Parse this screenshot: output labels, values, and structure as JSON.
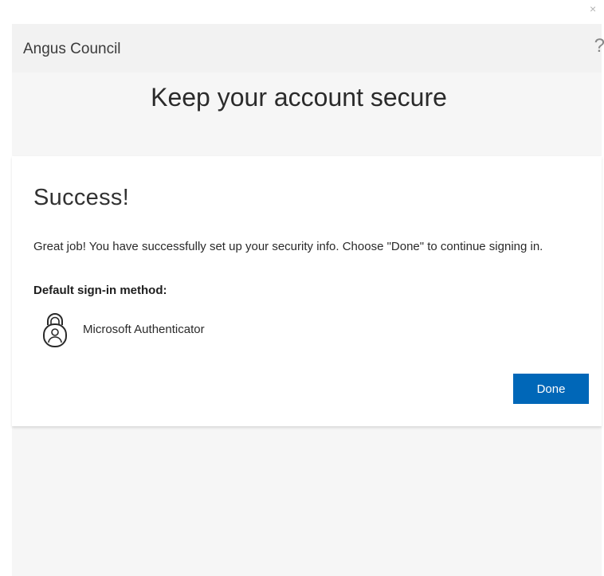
{
  "window": {
    "close_glyph": "×"
  },
  "header": {
    "org_name": "Angus Council",
    "help_glyph": "?"
  },
  "page": {
    "title": "Keep your account secure"
  },
  "card": {
    "heading": "Success!",
    "message": "Great job! You have successfully set up your security info. Choose \"Done\" to continue signing in.",
    "default_label": "Default sign-in method:",
    "method": {
      "name": "Microsoft Authenticator",
      "icon": "authenticator-lock-icon"
    },
    "done_label": "Done"
  },
  "colors": {
    "accent": "#0067b8",
    "panel_bg": "#f6f6f6",
    "header_bg": "#f2f2f2"
  }
}
